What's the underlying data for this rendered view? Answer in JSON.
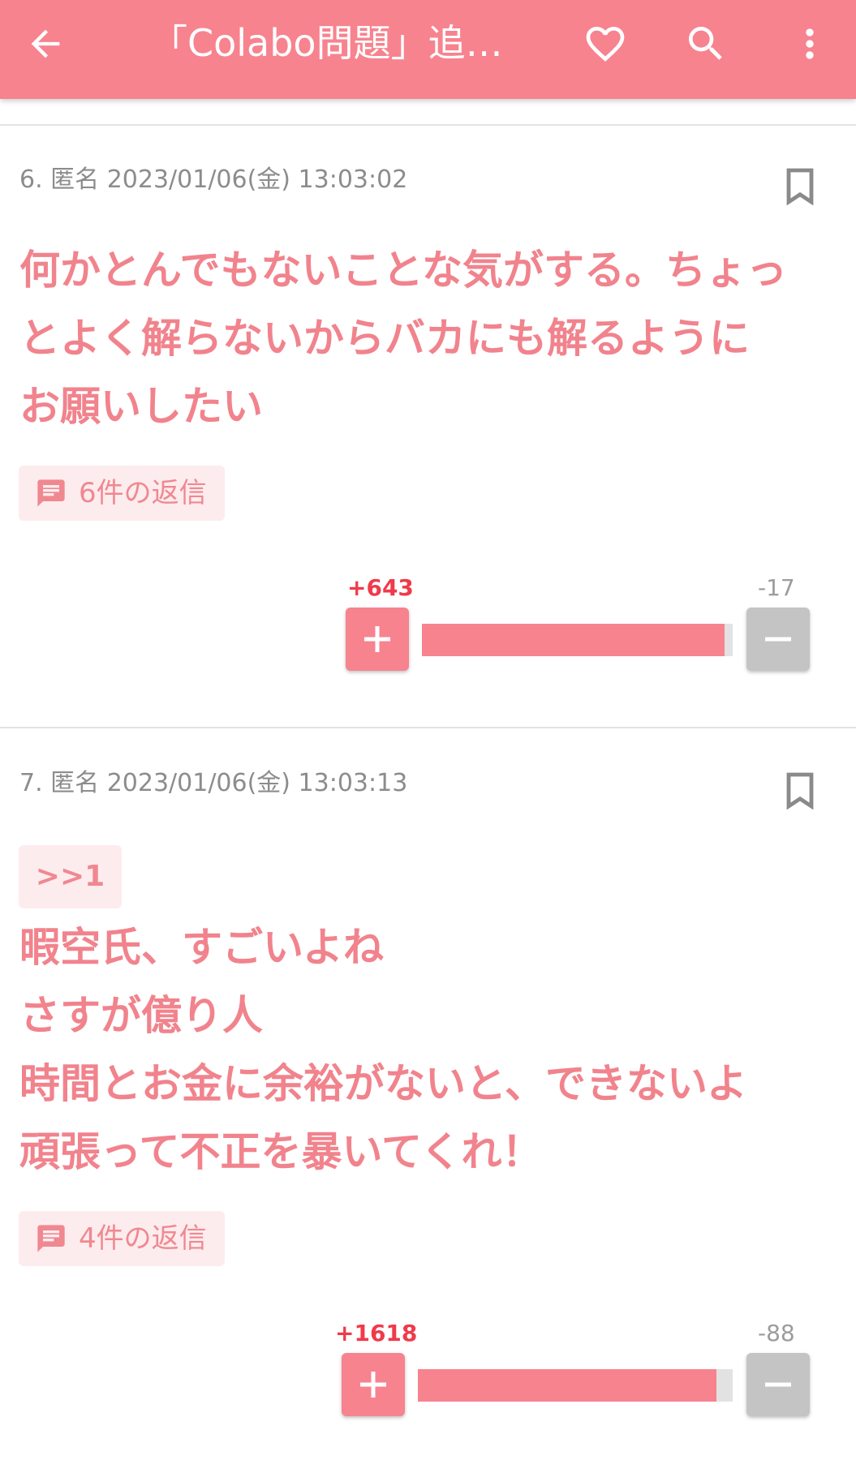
{
  "header": {
    "title": "「Colabo問題」追及の暇空茜氏、Colaboの不正を告発"
  },
  "colors": {
    "accent": "#f7838f",
    "body_text": "#f1838d",
    "plus_count": "#f03a4a",
    "minus_button": "#c4c4c4"
  },
  "icons": [
    "back-arrow-icon",
    "heart-icon",
    "search-icon",
    "more-vert-icon",
    "bookmark-icon",
    "chat-bubble-icon",
    "plus-icon",
    "minus-icon"
  ],
  "posts": [
    {
      "meta": "6. 匿名 2023/01/06(金) 13:03:02",
      "anchor": "",
      "lines": [
        "何かとんでもないことな気がする。ちょっ",
        "とよく解らないからバカにも解るように",
        "お願いしたい"
      ],
      "replies": "6件の返信",
      "plus": "+643",
      "minus": "-17",
      "plus_ratio": 0.974
    },
    {
      "meta": "7. 匿名 2023/01/06(金) 13:03:13",
      "anchor": ">>1",
      "lines": [
        "暇空氏、すごいよね",
        "さすが億り人",
        "時間とお金に余裕がないと、できないよ",
        "頑張って不正を暴いてくれ！"
      ],
      "replies": "4件の返信",
      "plus": "+1618",
      "minus": "-88",
      "plus_ratio": 0.948
    }
  ]
}
